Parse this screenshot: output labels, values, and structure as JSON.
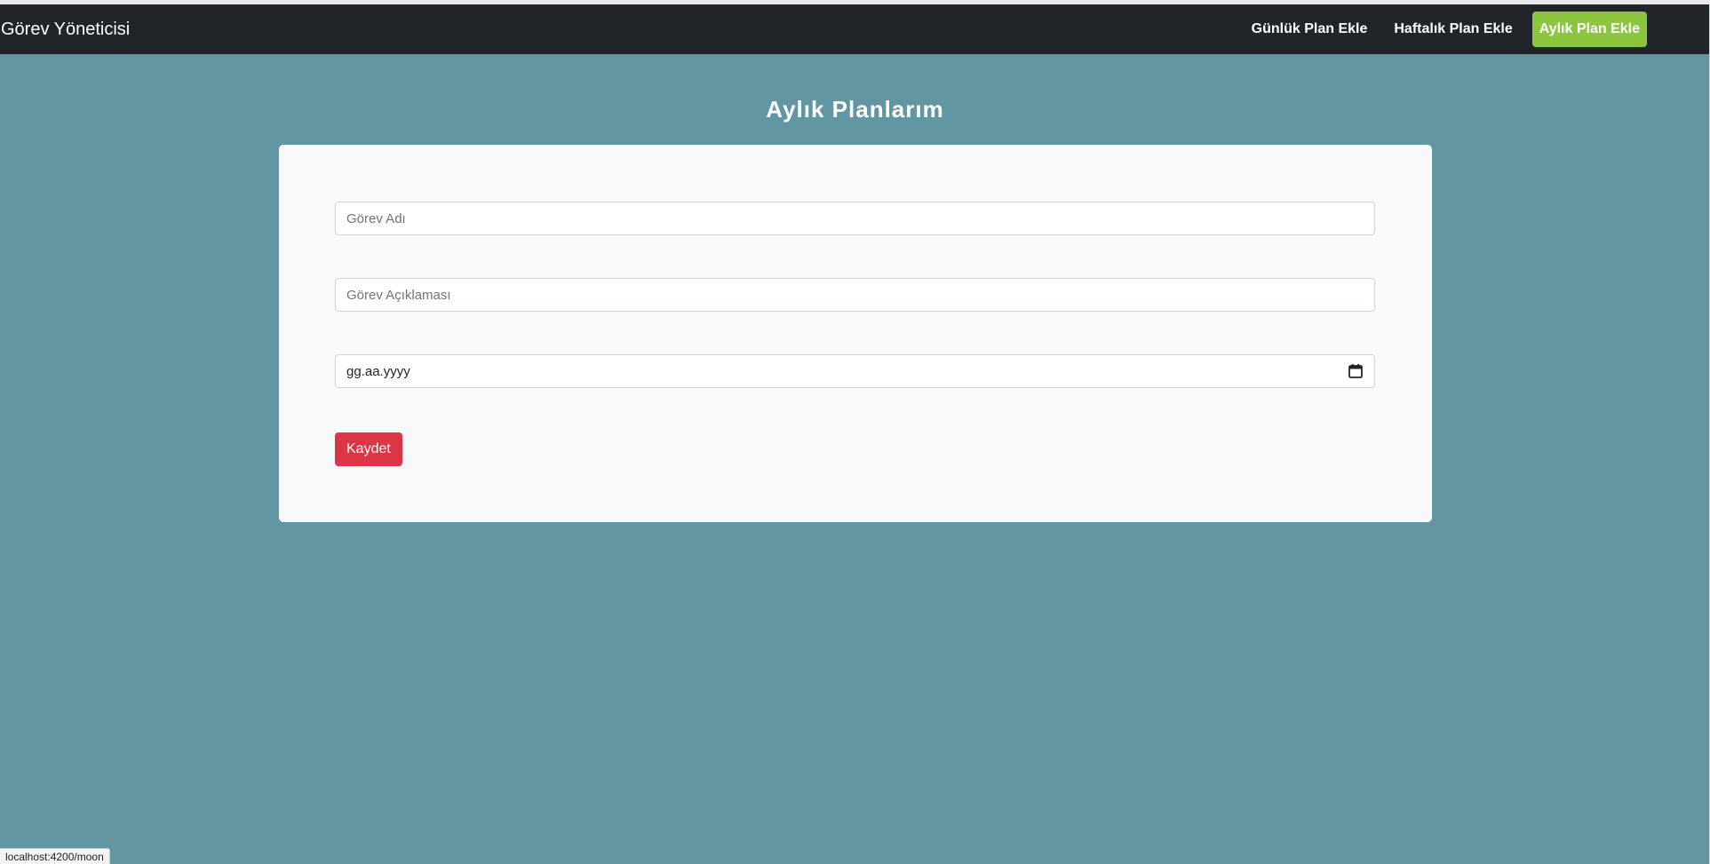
{
  "navbar": {
    "brand": "Görev Yöneticisi",
    "links": [
      {
        "label": "Günlük Plan Ekle"
      },
      {
        "label": "Haftalık Plan Ekle"
      },
      {
        "label": "Aylık Plan Ekle"
      }
    ],
    "active_color": "#8cc63f",
    "background": "#212529"
  },
  "page": {
    "title": "Aylık Planlarım",
    "background": "#6296a3"
  },
  "form": {
    "task_name_placeholder": "Görev Adı",
    "task_name_value": "",
    "task_description_placeholder": "Görev Açıklaması",
    "task_description_value": "",
    "date_display": "gg.aa.yyyy",
    "date_icon": "calendar-icon",
    "save_label": "Kaydet",
    "save_color": "#dc3545"
  },
  "status_bar": {
    "url": "localhost:4200/moon"
  }
}
